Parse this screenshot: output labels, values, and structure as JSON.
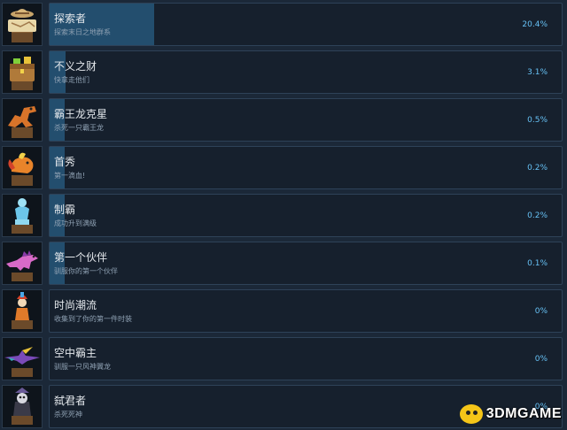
{
  "achievements": [
    {
      "title": "探索者",
      "description": "探索末日之地群系",
      "percent": "20.4%",
      "progress": 0.204,
      "icon": "explorer-hat-map-icon"
    },
    {
      "title": "不义之财",
      "description": "快拿走他们",
      "percent": "3.1%",
      "progress": 0.031,
      "icon": "treasure-chest-icon"
    },
    {
      "title": "霸王龙克星",
      "description": "杀死一只霸王龙",
      "percent": "0.5%",
      "progress": 0.005,
      "icon": "trex-icon"
    },
    {
      "title": "首秀",
      "description": "第一滴血!",
      "percent": "0.2%",
      "progress": 0.002,
      "icon": "fire-rooster-icon"
    },
    {
      "title": "制霸",
      "description": "成功升到满级",
      "percent": "0.2%",
      "progress": 0.002,
      "icon": "ice-statue-icon"
    },
    {
      "title": "第一个伙伴",
      "description": "驯服你的第一个伙伴",
      "percent": "0.1%",
      "progress": 0.001,
      "icon": "pink-dino-icon"
    },
    {
      "title": "时尚潮流",
      "description": "收集到了你的第一件时装",
      "percent": "0%",
      "progress": 0,
      "icon": "costume-icon"
    },
    {
      "title": "空中霸主",
      "description": "驯服一只风神翼龙",
      "percent": "0%",
      "progress": 0,
      "icon": "pterosaur-icon"
    },
    {
      "title": "弑君者",
      "description": "杀死死神",
      "percent": "0%",
      "progress": 0,
      "icon": "death-king-icon"
    }
  ],
  "watermark": {
    "text": "3DMGAME"
  },
  "colors": {
    "background": "#1b2838",
    "bar": "#16202d",
    "fill": "#234e6e",
    "accent": "#66c0f4"
  }
}
